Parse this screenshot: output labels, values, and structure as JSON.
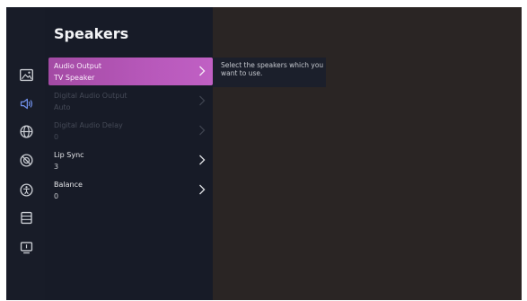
{
  "menu": {
    "title": "Speakers",
    "items": [
      {
        "label": "Audio Output",
        "value": "TV Speaker",
        "state": "selected"
      },
      {
        "label": "Digital Audio Output",
        "value": "Auto",
        "state": "disabled"
      },
      {
        "label": "Digital Audio Delay",
        "value": "0",
        "state": "disabled"
      },
      {
        "label": "Lip Sync",
        "value": "3",
        "state": "enabled"
      },
      {
        "label": "Balance",
        "value": "0",
        "state": "enabled"
      }
    ]
  },
  "tooltip": {
    "text": "Select the speakers which you want to use."
  },
  "sidebar": {
    "icons": [
      "picture-icon",
      "sound-icon",
      "network-icon",
      "general-icon",
      "accessibility-icon",
      "support-icon",
      "device-icon"
    ],
    "active": "sound-icon"
  },
  "colors": {
    "screen_bg": "#2a2524",
    "panel_bg": "#171b27",
    "iconbar_bg": "#181c28",
    "selected_start": "#a34aa4",
    "selected_end": "#c060c4",
    "active_icon": "#6f8fe8",
    "icon": "#c9ccd2"
  }
}
